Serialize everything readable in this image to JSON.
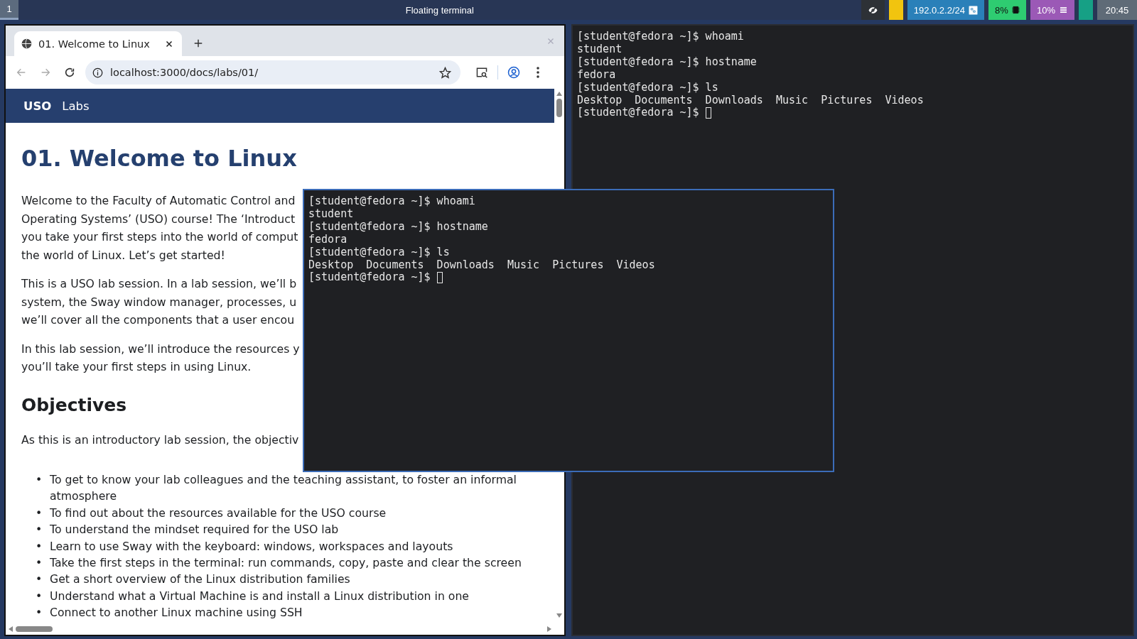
{
  "top_bar": {
    "workspaces": [
      {
        "label": "1",
        "selected": true
      }
    ],
    "title": "Floating terminal",
    "status_blocks": [
      {
        "kind": "privacy",
        "color": "#2d3136"
      },
      {
        "kind": "blank",
        "color": "#f1c40f"
      },
      {
        "kind": "network",
        "color": "#2a80b9",
        "text": "192.0.2.2/24"
      },
      {
        "kind": "memory",
        "color": "#2ecc71",
        "text": "8%"
      },
      {
        "kind": "cpu",
        "color": "#9b59b6",
        "text": "10%"
      },
      {
        "kind": "blank",
        "color": "#16a085"
      },
      {
        "kind": "clock",
        "color": "#5f6b77",
        "text": "20:45"
      }
    ]
  },
  "browser": {
    "tabs": [
      {
        "title": "01. Welcome to Linux",
        "selected": true
      }
    ],
    "address": "localhost:3000/docs/labs/01/",
    "site_nav": {
      "brand": "USO",
      "links": [
        "Labs"
      ]
    },
    "page": {
      "title": "01. Welcome to Linux",
      "blocks": [
        {
          "kind": "paragraph",
          "lines": [
            "Welcome to the Faculty of Automatic Control and",
            "Operating Systems’ (USO) course! The ‘Introduct",
            "you take your first steps into the world of comput",
            "the world of Linux. Let’s get started!"
          ]
        },
        {
          "kind": "paragraph",
          "lines": [
            "This is a USO lab session. In a lab session, we’ll b",
            "system, the Sway window manager, processes, u",
            "we’ll cover all the components that a user encou"
          ]
        },
        {
          "kind": "paragraph",
          "lines": [
            "In this lab session, we’ll introduce the resources y",
            "you’ll take your first steps in using Linux."
          ]
        },
        {
          "kind": "heading",
          "lines": [
            "Objectives"
          ]
        },
        {
          "kind": "paragraph",
          "lines": [
            "As this is an introductory lab session, the objectiv"
          ]
        },
        {
          "kind": "list",
          "marker": "•",
          "lines": [
            "To get to know your lab colleagues and the teaching assistant, to foster an informal atmosphere",
            "To find out about the resources available for the USO course",
            "To understand the mindset required for the USO lab",
            "Learn to use Sway with the keyboard: windows, workspaces and layouts",
            "Take the first steps in the terminal: run commands, copy, paste and clear the screen",
            "Get a short overview of the Linux distribution families",
            "Understand what a Virtual Machine is and install a Linux distribution in one",
            "Connect to another Linux machine using SSH"
          ]
        }
      ]
    }
  },
  "terminals": [
    {
      "focused": false,
      "cursor": true,
      "lines": [
        "[student@fedora ~]$ whoami",
        "student",
        "[student@fedora ~]$ hostname",
        "fedora",
        "[student@fedora ~]$ ls",
        "Desktop  Documents  Downloads  Music  Pictures  Videos",
        "[student@fedora ~]$ "
      ]
    },
    {
      "focused": true,
      "cursor": true,
      "lines": [
        "[student@fedora ~]$ whoami",
        "student",
        "[student@fedora ~]$ hostname",
        "fedora",
        "[student@fedora ~]$ ls",
        "Desktop  Documents  Downloads  Music  Pictures  Videos",
        "[student@fedora ~]$ "
      ]
    }
  ]
}
